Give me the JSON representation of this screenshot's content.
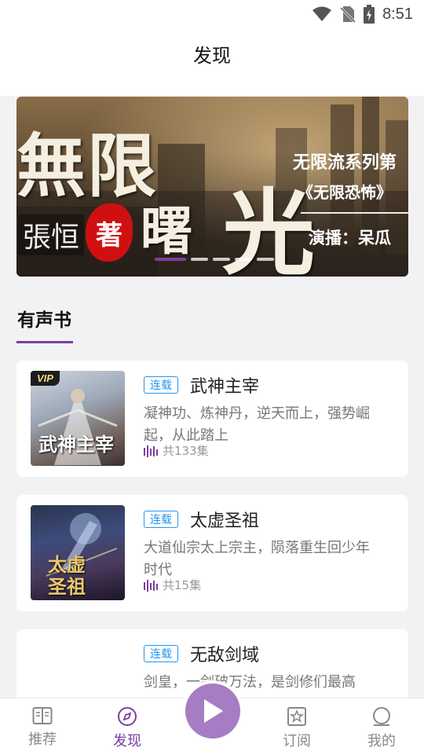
{
  "status_bar": {
    "time": "8:51"
  },
  "header": {
    "title": "发现"
  },
  "banner": {
    "title_big1": "無限",
    "title_big2": "曙",
    "title_big3": "光",
    "author": "張恒",
    "seal": "著",
    "side_line1": "无限流系列第",
    "side_line2": "《无限恐怖》",
    "side_line3": "演播：呆瓜"
  },
  "section": {
    "title": "有声书"
  },
  "books": [
    {
      "status": "连载",
      "title": "武神主宰",
      "desc": "凝神功、炼神丹，逆天而上，强势崛起，从此踏上",
      "count": "共133集",
      "vip": "VIP",
      "cover_text": "武神主宰"
    },
    {
      "status": "连载",
      "title": "太虚圣祖",
      "desc": "大道仙宗太上宗主，陨落重生回少年时代",
      "count": "共15集",
      "cover_text": "太虚圣祖"
    },
    {
      "status": "连载",
      "title": "无敌剑域",
      "desc": "剑皇，一剑破万法，是剑修们最高"
    }
  ],
  "nav": {
    "items": [
      {
        "label": "推荐",
        "icon": "book-icon"
      },
      {
        "label": "发现",
        "icon": "compass-icon"
      },
      {
        "label": "订阅",
        "icon": "star-bookmark-icon"
      },
      {
        "label": "我的",
        "icon": "user-icon"
      }
    ],
    "active": "发现",
    "play_icon": "play-icon"
  },
  "colors": {
    "accent": "#7b3fa0",
    "badge": "#2196f3",
    "play": "#a67dc4"
  }
}
